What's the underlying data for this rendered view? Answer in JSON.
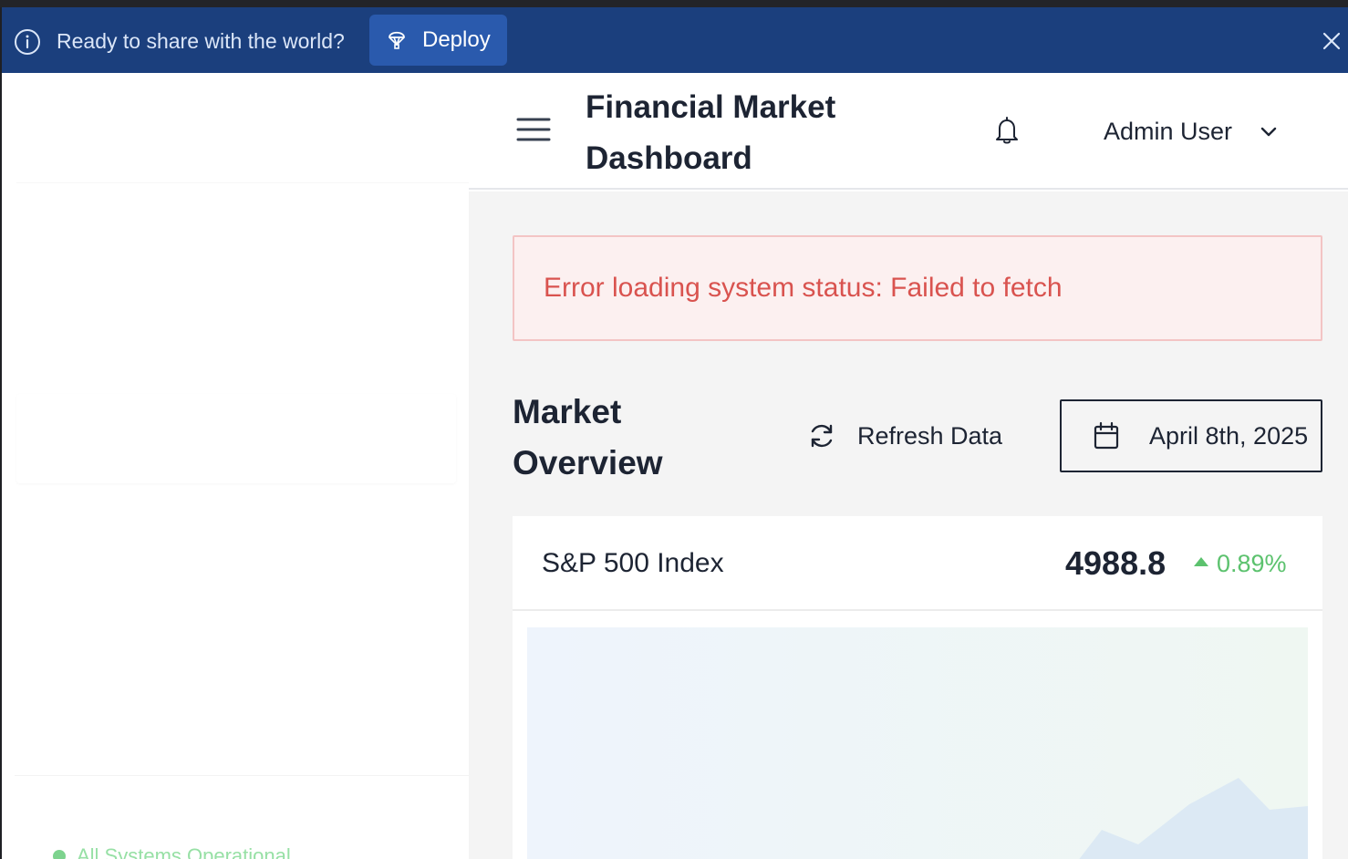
{
  "banner": {
    "message": "Ready to share with the world?",
    "deploy_label": "Deploy",
    "icons": {
      "info": "info-icon",
      "deploy": "deploy-icon",
      "close": "close-icon"
    }
  },
  "header": {
    "title": "Financial Market Dashboard",
    "user_name": "Admin User",
    "icons": {
      "menu": "menu-icon",
      "notifications": "bell-icon",
      "user_menu": "chevron-down-icon"
    }
  },
  "sidebar": {
    "status_text": "All Systems Operational",
    "status_color": "#7dd38e"
  },
  "alert": {
    "error_text": "Error loading system status: Failed to fetch",
    "color": "#d9534f"
  },
  "market": {
    "section_title": "Market Overview",
    "refresh_label": "Refresh Data",
    "date_value": "April 8th, 2025",
    "icons": {
      "refresh": "refresh-icon",
      "date": "calendar-icon"
    }
  },
  "index_card": {
    "name": "S&P 500 Index",
    "value": "4988.8",
    "change": "0.89%",
    "change_direction": "up",
    "change_color": "#5cc26e"
  },
  "colors": {
    "banner_bg": "#1b3f7d",
    "deploy_button": "#2a5aad",
    "main_bg": "#f4f4f4",
    "text_primary": "#1d2433"
  }
}
